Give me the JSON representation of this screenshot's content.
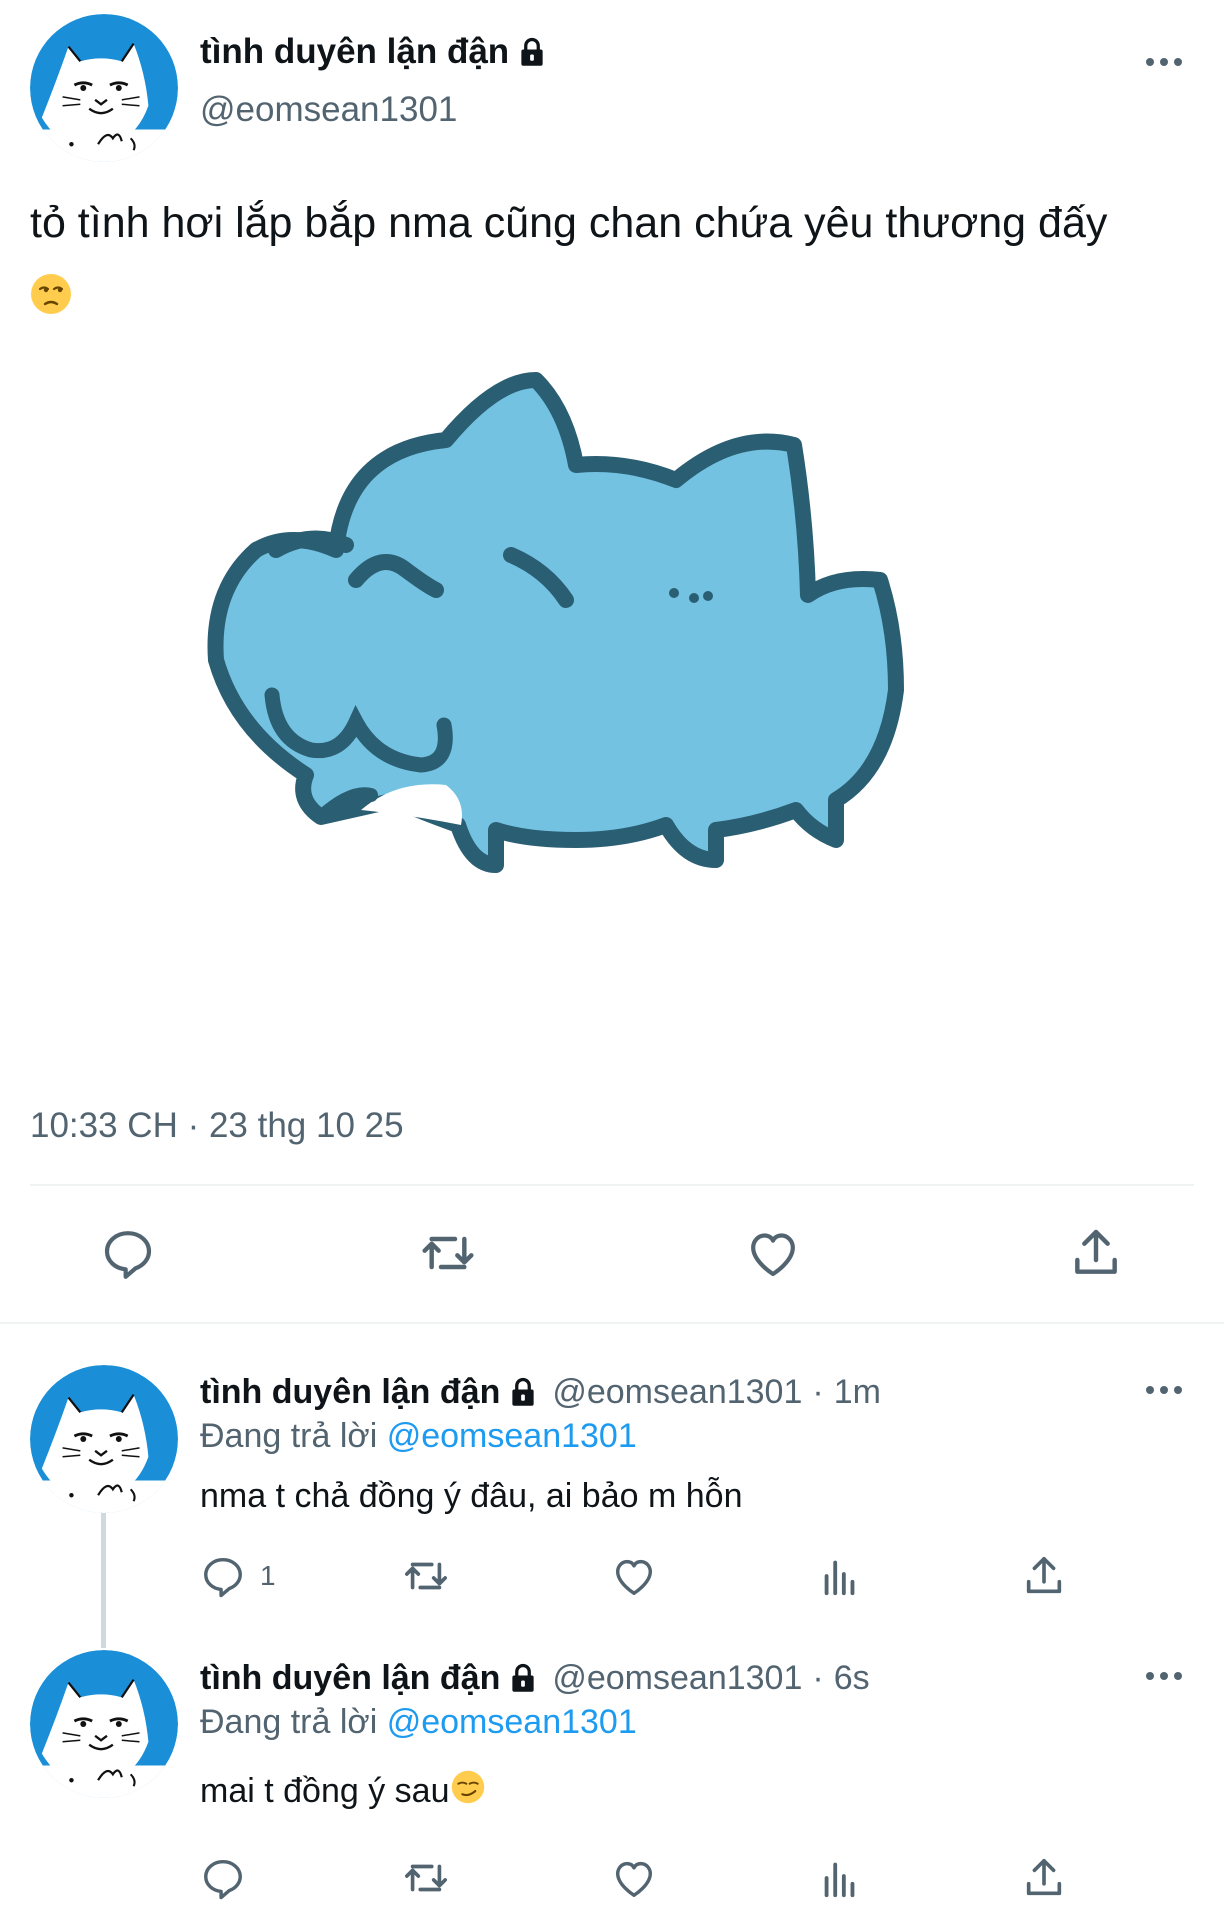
{
  "main_tweet": {
    "display_name": "tình duyên lận đận",
    "handle": "@eomsean1301",
    "text": "tỏ tình hơi lắp bắp nma cũng chan chứa yêu thương đấy",
    "emoji": "😒",
    "timestamp": "10:33 CH · 23 thg 10 25"
  },
  "replies": [
    {
      "display_name": "tình duyên lận đận",
      "handle": "@eomsean1301",
      "separator": "·",
      "time": "1m",
      "replying_prefix": "Đang trả lời",
      "replying_to": "@eomsean1301",
      "text": "nma t chả đồng ý đâu, ai bảo m hỗn",
      "reply_count": "1"
    },
    {
      "display_name": "tình duyên lận đận",
      "handle": "@eomsean1301",
      "separator": "·",
      "time": "6s",
      "replying_prefix": "Đang trả lời",
      "replying_to": "@eomsean1301",
      "text": "mai t đồng ý sau",
      "emoji": "😏",
      "reply_count": ""
    }
  ],
  "icons": {
    "reply": "reply-icon",
    "retweet": "retweet-icon",
    "like": "heart-icon",
    "share": "share-icon",
    "views": "analytics-icon",
    "more": "more-icon",
    "lock": "lock-icon"
  },
  "colors": {
    "text": "#0f1419",
    "secondary": "#536471",
    "link": "#1d9bf0",
    "divider": "#eff3f4",
    "avatar_blue": "#1a8fd8",
    "sticker_blue": "#74c2e1"
  }
}
